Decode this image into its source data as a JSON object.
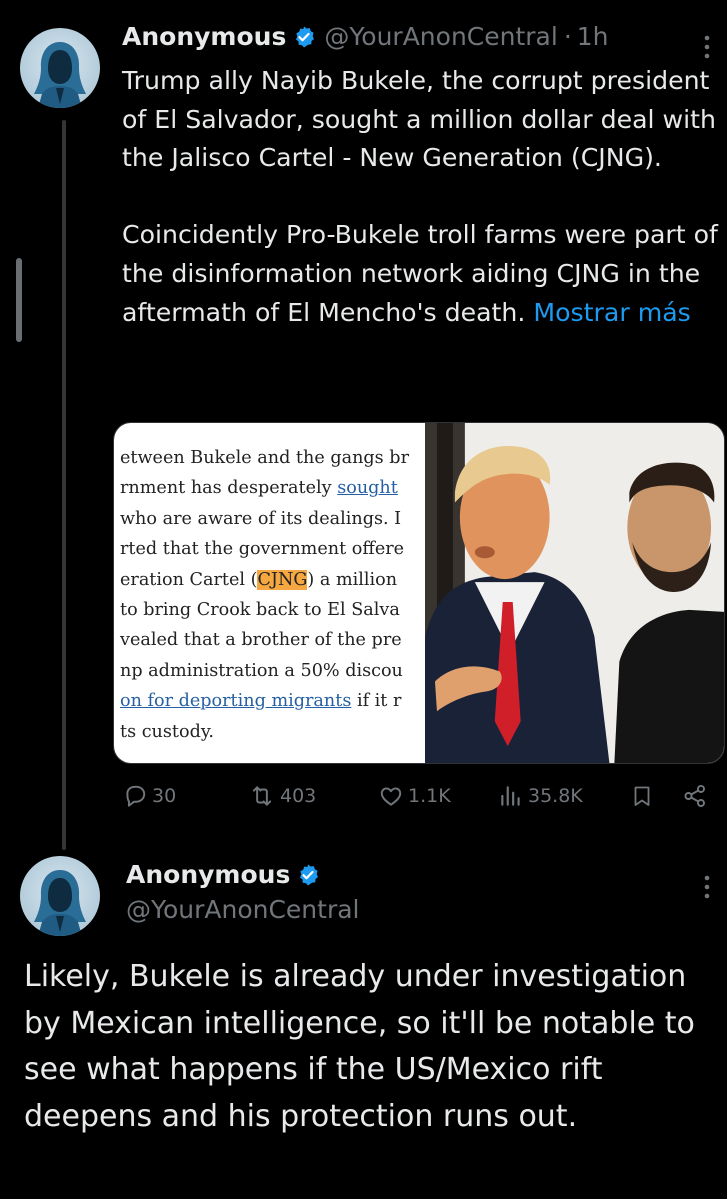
{
  "tweet1": {
    "author_name": "Anonymous",
    "handle": "@YourAnonCentral",
    "separator": "·",
    "time": "1h",
    "text": "Trump ally Nayib Bukele, the corrupt president of El Salvador, sought a million dollar deal with the Jalisco Cartel - New Generation (CJNG).\n\nCoincidently Pro-Bukele troll farms were part of the disinformation network aiding CJNG in the aftermath of El Mencho's death. ",
    "show_more": "Mostrar más",
    "media": {
      "news_clip": [
        {
          "pre": "etween Bukele and the gangs br",
          "hl": "",
          "link": "",
          "post": ""
        },
        {
          "pre": "rnment has desperately ",
          "hl": "",
          "link": "sought",
          "post": ""
        },
        {
          "pre": "  who are aware of its dealings. I",
          "hl": "",
          "link": "",
          "post": ""
        },
        {
          "pre": "rted that the government offere",
          "hl": "",
          "link": "",
          "post": ""
        },
        {
          "pre": "eration Cartel (",
          "hl": "CJNG",
          "link": "",
          "post": ") a million"
        },
        {
          "pre": "  to bring Crook back to El Salva",
          "hl": "",
          "link": "",
          "post": ""
        },
        {
          "pre": "vealed that a brother of the pre",
          "hl": "",
          "link": "",
          "post": ""
        },
        {
          "pre": "np administration a 50% discou",
          "hl": "",
          "link": "",
          "post": ""
        },
        {
          "pre": "",
          "hl": "",
          "link": "on for deporting migrants",
          "post": " if it r"
        },
        {
          "pre": "ts custody.",
          "hl": "",
          "link": "",
          "post": ""
        }
      ]
    },
    "actions": {
      "replies": "30",
      "reposts": "403",
      "likes": "1.1K",
      "views": "35.8K"
    }
  },
  "tweet2": {
    "author_name": "Anonymous",
    "handle": "@YourAnonCentral",
    "text": "Likely, Bukele is already under investigation by Mexican intelligence, so it'll be notable to see what happens if the US/Mexico rift deepens and his protection runs out."
  },
  "icons": {
    "verified": "verified-badge-icon",
    "more": "more-vertical-icon",
    "reply": "reply-icon",
    "repost": "repost-icon",
    "like": "like-icon",
    "views": "views-icon",
    "bookmark": "bookmark-icon",
    "share": "share-icon"
  },
  "colors": {
    "background": "#000000",
    "text": "#e7e9ea",
    "muted": "#71767b",
    "link": "#1d9bf0",
    "verified": "#1d9bf0",
    "highlight": "#f5a742"
  }
}
